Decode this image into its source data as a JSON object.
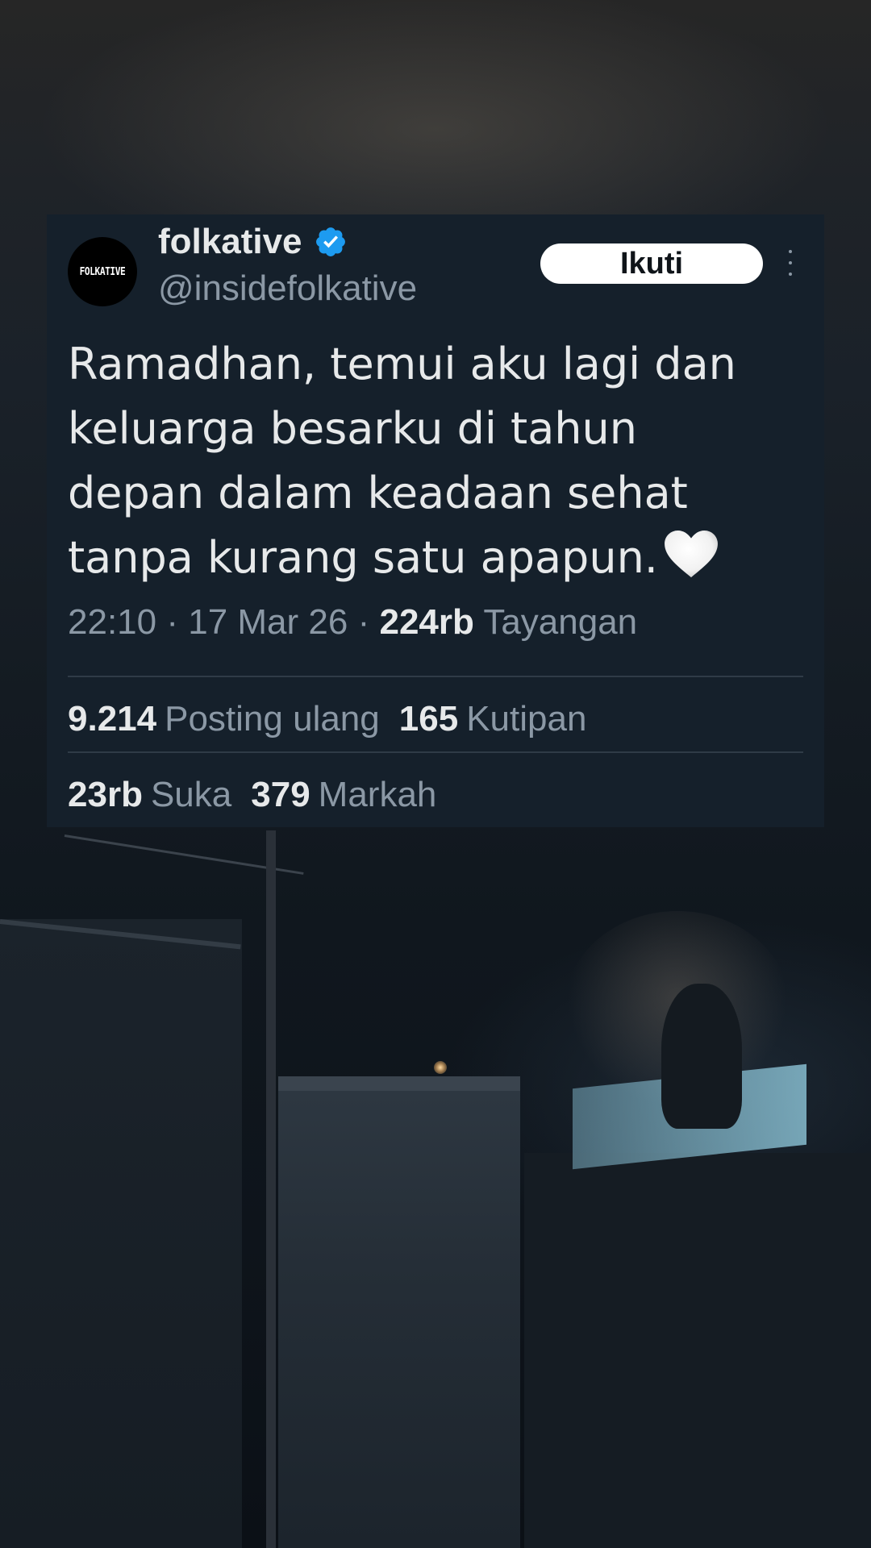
{
  "tweet": {
    "avatar_text": "FOLKATIVE",
    "display_name": "folkative",
    "verified_icon": "verified-badge-icon",
    "handle": "@insidefolkative",
    "follow_label": "Ikuti",
    "more_icon": "more-vertical-icon",
    "text": "Ramadhan, temui aku lagi dan\nkeluarga besarku di tahun\ndepan dalam keadaan sehat\ntanpa kurang satu apapun.",
    "emoji": "white-heart-emoji",
    "time": "22:10",
    "date": "17 Mar 26",
    "separator": "·",
    "views_count": "224rb",
    "views_label": "Tayangan",
    "reposts_count": "9.214",
    "reposts_label": "Posting ulang",
    "quotes_count": "165",
    "quotes_label": "Kutipan",
    "likes_count": "23rb",
    "likes_label": "Suka",
    "bookmarks_count": "379",
    "bookmarks_label": "Markah"
  },
  "colors": {
    "card_background": "#15202b",
    "primary_text": "#e7e9ea",
    "secondary_text": "#8b98a5",
    "verified_blue": "#1d9bf0",
    "divider": "#2f3b47"
  }
}
